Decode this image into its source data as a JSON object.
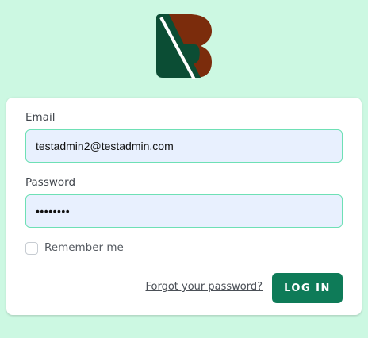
{
  "brand": {
    "logo_icon": "b-logo-icon",
    "colors": {
      "dark_green": "#0b4d34",
      "brown": "#7b2c0c",
      "slash": "#ffffff"
    }
  },
  "form": {
    "email_label": "Email",
    "email_value": "testadmin2@testadmin.com",
    "password_label": "Password",
    "password_value": "••••••••",
    "remember_label": "Remember me",
    "remember_checked": false,
    "forgot_link": "Forgot your password?",
    "login_button": "LOG IN"
  },
  "colors": {
    "page_background": "#ccf8e2",
    "card_background": "#ffffff",
    "input_background": "#e8f0fe",
    "input_border": "#6ee0b5",
    "button_background": "#0e7b58"
  }
}
